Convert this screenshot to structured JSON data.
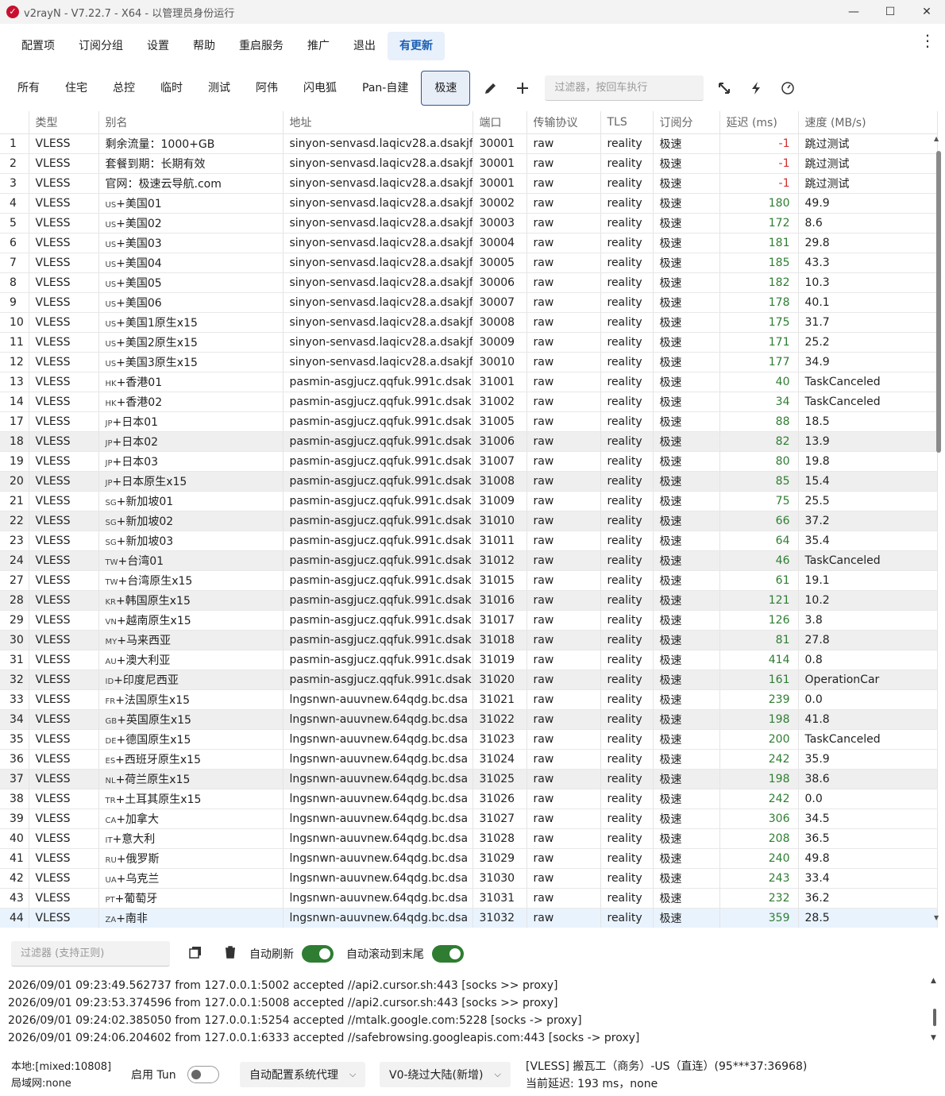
{
  "window": {
    "title": "v2rayN - V7.22.7 - X64 - 以管理员身份运行",
    "min": "—",
    "max": "☐",
    "close": "✕"
  },
  "menu": [
    "配置项",
    "订阅分组",
    "设置",
    "帮助",
    "重启服务",
    "推广",
    "退出",
    "有更新"
  ],
  "tabs": [
    "所有",
    "住宅",
    "总控",
    "临时",
    "测试",
    "阿伟",
    "闪电狐",
    "Pan-自建",
    "极速"
  ],
  "active_tab": "极速",
  "toolbar": {
    "filter_placeholder": "过滤器，按回车执行",
    "icons": [
      "pencil-icon",
      "plus-icon",
      "expand-icon",
      "lightning-icon",
      "speedometer-icon"
    ]
  },
  "columns": [
    "",
    "类型",
    "别名",
    "地址",
    "端口",
    "传输协议",
    "TLS",
    "订阅分",
    "延迟 (ms)",
    "速度 (MB/s)"
  ],
  "rows": [
    [
      "1",
      "VLESS",
      "",
      "剩余流量：1000+GB",
      "sinyon-senvasd.laqicv28.a.dsakjf",
      "30001",
      "raw",
      "reality",
      "极速",
      "-1",
      "跳过测试"
    ],
    [
      "2",
      "VLESS",
      "",
      "套餐到期：长期有效",
      "sinyon-senvasd.laqicv28.a.dsakjf",
      "30001",
      "raw",
      "reality",
      "极速",
      "-1",
      "跳过测试"
    ],
    [
      "3",
      "VLESS",
      "",
      "官网：极速云导航.com",
      "sinyon-senvasd.laqicv28.a.dsakjf",
      "30001",
      "raw",
      "reality",
      "极速",
      "-1",
      "跳过测试"
    ],
    [
      "4",
      "VLESS",
      "US",
      "+美国01",
      "sinyon-senvasd.laqicv28.a.dsakjf",
      "30002",
      "raw",
      "reality",
      "极速",
      "180",
      "49.9"
    ],
    [
      "5",
      "VLESS",
      "US",
      "+美国02",
      "sinyon-senvasd.laqicv28.a.dsakjf",
      "30003",
      "raw",
      "reality",
      "极速",
      "172",
      "8.6"
    ],
    [
      "6",
      "VLESS",
      "US",
      "+美国03",
      "sinyon-senvasd.laqicv28.a.dsakjf",
      "30004",
      "raw",
      "reality",
      "极速",
      "181",
      "29.8"
    ],
    [
      "7",
      "VLESS",
      "US",
      "+美国04",
      "sinyon-senvasd.laqicv28.a.dsakjf",
      "30005",
      "raw",
      "reality",
      "极速",
      "185",
      "43.3"
    ],
    [
      "8",
      "VLESS",
      "US",
      "+美国05",
      "sinyon-senvasd.laqicv28.a.dsakjf",
      "30006",
      "raw",
      "reality",
      "极速",
      "182",
      "10.3"
    ],
    [
      "9",
      "VLESS",
      "US",
      "+美国06",
      "sinyon-senvasd.laqicv28.a.dsakjf",
      "30007",
      "raw",
      "reality",
      "极速",
      "178",
      "40.1"
    ],
    [
      "10",
      "VLESS",
      "US",
      "+美国1原生x15",
      "sinyon-senvasd.laqicv28.a.dsakjf",
      "30008",
      "raw",
      "reality",
      "极速",
      "175",
      "31.7"
    ],
    [
      "11",
      "VLESS",
      "US",
      "+美国2原生x15",
      "sinyon-senvasd.laqicv28.a.dsakjf",
      "30009",
      "raw",
      "reality",
      "极速",
      "171",
      "25.2"
    ],
    [
      "12",
      "VLESS",
      "US",
      "+美国3原生x15",
      "sinyon-senvasd.laqicv28.a.dsakjf",
      "30010",
      "raw",
      "reality",
      "极速",
      "177",
      "34.9"
    ],
    [
      "13",
      "VLESS",
      "HK",
      "+香港01",
      "pasmin-asgjucz.qqfuk.991c.dsak",
      "31001",
      "raw",
      "reality",
      "极速",
      "40",
      "TaskCanceled"
    ],
    [
      "14",
      "VLESS",
      "HK",
      "+香港02",
      "pasmin-asgjucz.qqfuk.991c.dsak",
      "31002",
      "raw",
      "reality",
      "极速",
      "34",
      "TaskCanceled"
    ],
    [
      "17",
      "VLESS",
      "JP",
      "+日本01",
      "pasmin-asgjucz.qqfuk.991c.dsak",
      "31005",
      "raw",
      "reality",
      "极速",
      "88",
      "18.5"
    ],
    [
      "18",
      "VLESS",
      "JP",
      "+日本02",
      "pasmin-asgjucz.qqfuk.991c.dsak",
      "31006",
      "raw",
      "reality",
      "极速",
      "82",
      "13.9"
    ],
    [
      "19",
      "VLESS",
      "JP",
      "+日本03",
      "pasmin-asgjucz.qqfuk.991c.dsak",
      "31007",
      "raw",
      "reality",
      "极速",
      "80",
      "19.8"
    ],
    [
      "20",
      "VLESS",
      "JP",
      "+日本原生x15",
      "pasmin-asgjucz.qqfuk.991c.dsak",
      "31008",
      "raw",
      "reality",
      "极速",
      "85",
      "15.4"
    ],
    [
      "21",
      "VLESS",
      "SG",
      "+新加坡01",
      "pasmin-asgjucz.qqfuk.991c.dsak",
      "31009",
      "raw",
      "reality",
      "极速",
      "75",
      "25.5"
    ],
    [
      "22",
      "VLESS",
      "SG",
      "+新加坡02",
      "pasmin-asgjucz.qqfuk.991c.dsak",
      "31010",
      "raw",
      "reality",
      "极速",
      "66",
      "37.2"
    ],
    [
      "23",
      "VLESS",
      "SG",
      "+新加坡03",
      "pasmin-asgjucz.qqfuk.991c.dsak",
      "31011",
      "raw",
      "reality",
      "极速",
      "64",
      "35.4"
    ],
    [
      "24",
      "VLESS",
      "TW",
      "+台湾01",
      "pasmin-asgjucz.qqfuk.991c.dsak",
      "31012",
      "raw",
      "reality",
      "极速",
      "46",
      "TaskCanceled"
    ],
    [
      "27",
      "VLESS",
      "TW",
      "+台湾原生x15",
      "pasmin-asgjucz.qqfuk.991c.dsak",
      "31015",
      "raw",
      "reality",
      "极速",
      "61",
      "19.1"
    ],
    [
      "28",
      "VLESS",
      "KR",
      "+韩国原生x15",
      "pasmin-asgjucz.qqfuk.991c.dsak",
      "31016",
      "raw",
      "reality",
      "极速",
      "121",
      "10.2"
    ],
    [
      "29",
      "VLESS",
      "VN",
      "+越南原生x15",
      "pasmin-asgjucz.qqfuk.991c.dsak",
      "31017",
      "raw",
      "reality",
      "极速",
      "126",
      "3.8"
    ],
    [
      "30",
      "VLESS",
      "MY",
      "+马来西亚",
      "pasmin-asgjucz.qqfuk.991c.dsak",
      "31018",
      "raw",
      "reality",
      "极速",
      "81",
      "27.8"
    ],
    [
      "31",
      "VLESS",
      "AU",
      "+澳大利亚",
      "pasmin-asgjucz.qqfuk.991c.dsak",
      "31019",
      "raw",
      "reality",
      "极速",
      "414",
      "0.8"
    ],
    [
      "32",
      "VLESS",
      "ID",
      "+印度尼西亚",
      "pasmin-asgjucz.qqfuk.991c.dsak",
      "31020",
      "raw",
      "reality",
      "极速",
      "161",
      "OperationCar"
    ],
    [
      "33",
      "VLESS",
      "FR",
      "+法国原生x15",
      "lngsnwn-auuvnew.64qdg.bc.dsa",
      "31021",
      "raw",
      "reality",
      "极速",
      "239",
      "0.0"
    ],
    [
      "34",
      "VLESS",
      "GB",
      "+英国原生x15",
      "lngsnwn-auuvnew.64qdg.bc.dsa",
      "31022",
      "raw",
      "reality",
      "极速",
      "198",
      "41.8"
    ],
    [
      "35",
      "VLESS",
      "DE",
      "+德国原生x15",
      "lngsnwn-auuvnew.64qdg.bc.dsa",
      "31023",
      "raw",
      "reality",
      "极速",
      "200",
      "TaskCanceled"
    ],
    [
      "36",
      "VLESS",
      "ES",
      "+西班牙原生x15",
      "lngsnwn-auuvnew.64qdg.bc.dsa",
      "31024",
      "raw",
      "reality",
      "极速",
      "242",
      "35.9"
    ],
    [
      "37",
      "VLESS",
      "NL",
      "+荷兰原生x15",
      "lngsnwn-auuvnew.64qdg.bc.dsa",
      "31025",
      "raw",
      "reality",
      "极速",
      "198",
      "38.6"
    ],
    [
      "38",
      "VLESS",
      "TR",
      "+土耳其原生x15",
      "lngsnwn-auuvnew.64qdg.bc.dsa",
      "31026",
      "raw",
      "reality",
      "极速",
      "242",
      "0.0"
    ],
    [
      "39",
      "VLESS",
      "CA",
      "+加拿大",
      "lngsnwn-auuvnew.64qdg.bc.dsa",
      "31027",
      "raw",
      "reality",
      "极速",
      "306",
      "34.5"
    ],
    [
      "40",
      "VLESS",
      "IT",
      "+意大利",
      "lngsnwn-auuvnew.64qdg.bc.dsa",
      "31028",
      "raw",
      "reality",
      "极速",
      "208",
      "36.5"
    ],
    [
      "41",
      "VLESS",
      "RU",
      "+俄罗斯",
      "lngsnwn-auuvnew.64qdg.bc.dsa",
      "31029",
      "raw",
      "reality",
      "极速",
      "240",
      "49.8"
    ],
    [
      "42",
      "VLESS",
      "UA",
      "+乌克兰",
      "lngsnwn-auuvnew.64qdg.bc.dsa",
      "31030",
      "raw",
      "reality",
      "极速",
      "243",
      "33.4"
    ],
    [
      "43",
      "VLESS",
      "PT",
      "+葡萄牙",
      "lngsnwn-auuvnew.64qdg.bc.dsa",
      "31031",
      "raw",
      "reality",
      "极速",
      "232",
      "36.2"
    ],
    [
      "44",
      "VLESS",
      "ZA",
      "+南非",
      "lngsnwn-auuvnew.64qdg.bc.dsa",
      "31032",
      "raw",
      "reality",
      "极速",
      "359",
      "28.5"
    ]
  ],
  "shaded_rows": [
    "18",
    "20",
    "22",
    "24",
    "28",
    "30",
    "32",
    "34",
    "37"
  ],
  "selected_row": "44",
  "log": {
    "filter_placeholder": "过滤器 (支持正则)",
    "auto_refresh": "自动刷新",
    "auto_scroll": "自动滚动到末尾",
    "lines": [
      "2026/09/01 09:23:49.562737 from 127.0.0.1:5002 accepted //api2.cursor.sh:443 [socks >> proxy]",
      "2026/09/01 09:23:53.374596 from 127.0.0.1:5008 accepted //api2.cursor.sh:443 [socks >> proxy]",
      "2026/09/01 09:24:02.385050 from 127.0.0.1:5254 accepted //mtalk.google.com:5228 [socks -> proxy]",
      "2026/09/01 09:24:06.204602 from 127.0.0.1:6333 accepted //safebrowsing.googleapis.com:443 [socks -> proxy]"
    ]
  },
  "status": {
    "local": "本地:[mixed:10808]",
    "lan": "局域网:none",
    "tun_label": "启用 Tun",
    "sysproxy": "自动配置系统代理",
    "routing": "V0-绕过大陆(新增)",
    "server": "[VLESS] 搬瓦工（商务）-US（直连）(95***37:36968)",
    "delay": "当前延迟: 193 ms，none"
  }
}
